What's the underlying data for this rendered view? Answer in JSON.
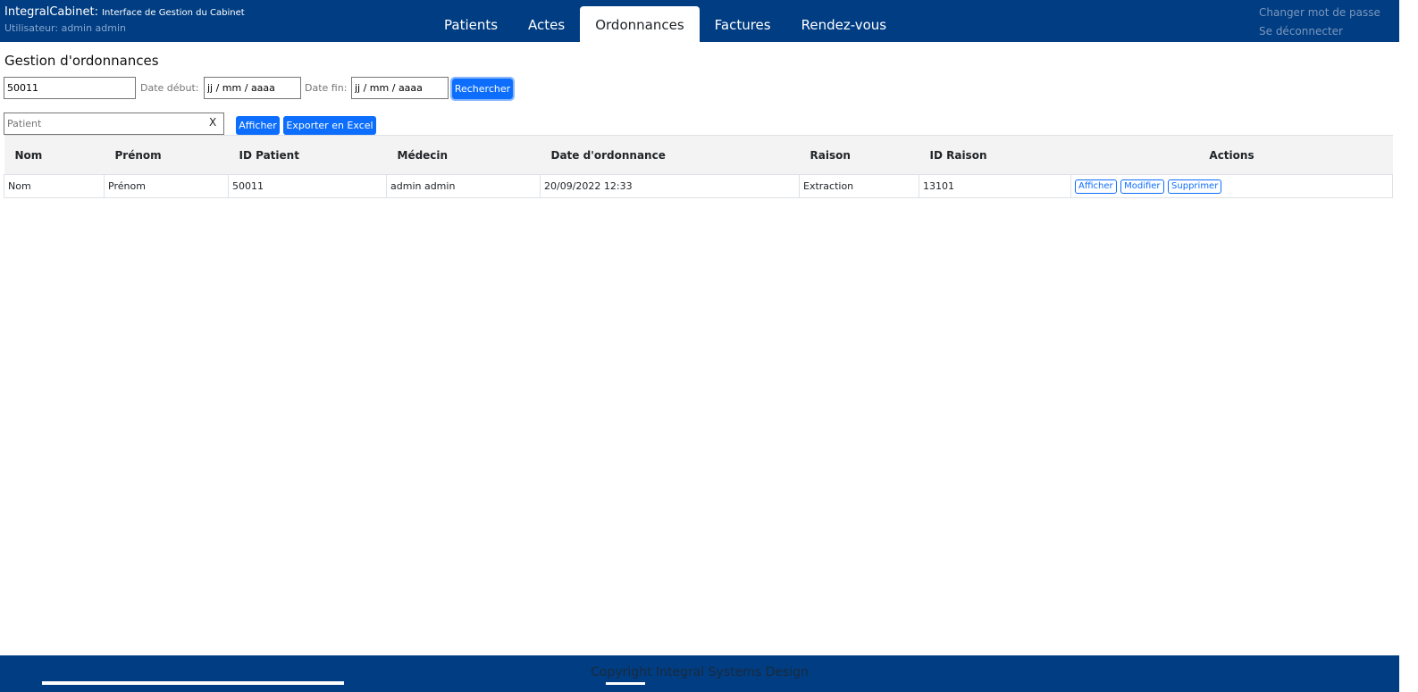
{
  "header": {
    "app_name": "IntegralCabinet:",
    "app_subtitle": "Interface de Gestion du Cabinet",
    "user_line": "Utilisateur: admin admin",
    "colors": {
      "primary": "#003d82",
      "accent": "#0d6efd"
    }
  },
  "nav": {
    "tabs": [
      {
        "label": "Patients",
        "active": false
      },
      {
        "label": "Actes",
        "active": false
      },
      {
        "label": "Ordonnances",
        "active": true
      },
      {
        "label": "Factures",
        "active": false
      },
      {
        "label": "Rendez-vous",
        "active": false
      }
    ]
  },
  "top_links": {
    "change_password": "Changer mot de passe",
    "logout": "Se déconnecter"
  },
  "page": {
    "title": "Gestion d'ordonnances"
  },
  "filters": {
    "patient_id_value": "50011",
    "date_start_label": "Date début:",
    "date_start_value": "jj / mm / aaaa",
    "date_end_label": "Date fin:",
    "date_end_value": "jj / mm / aaaa",
    "search_button": "Rechercher",
    "patient_placeholder": "Patient",
    "clear_label": "X",
    "show_button": "Afficher",
    "export_button": "Exporter en Excel"
  },
  "table": {
    "headers": {
      "nom": "Nom",
      "prenom": "Prénom",
      "id_patient": "ID Patient",
      "medecin": "Médecin",
      "date": "Date d'ordonnance",
      "raison": "Raison",
      "id_raison": "ID Raison",
      "actions": "Actions"
    },
    "rows": [
      {
        "nom": "Nom",
        "prenom": "Prénom",
        "id_patient": "50011",
        "medecin": "admin admin",
        "date": "20/09/2022 12:33",
        "raison": "Extraction",
        "id_raison": "13101",
        "actions": {
          "view": "Afficher",
          "edit": "Modifier",
          "delete": "Supprimer"
        }
      }
    ]
  },
  "footer": {
    "copyright": "Copyright Integral Systems Design"
  }
}
